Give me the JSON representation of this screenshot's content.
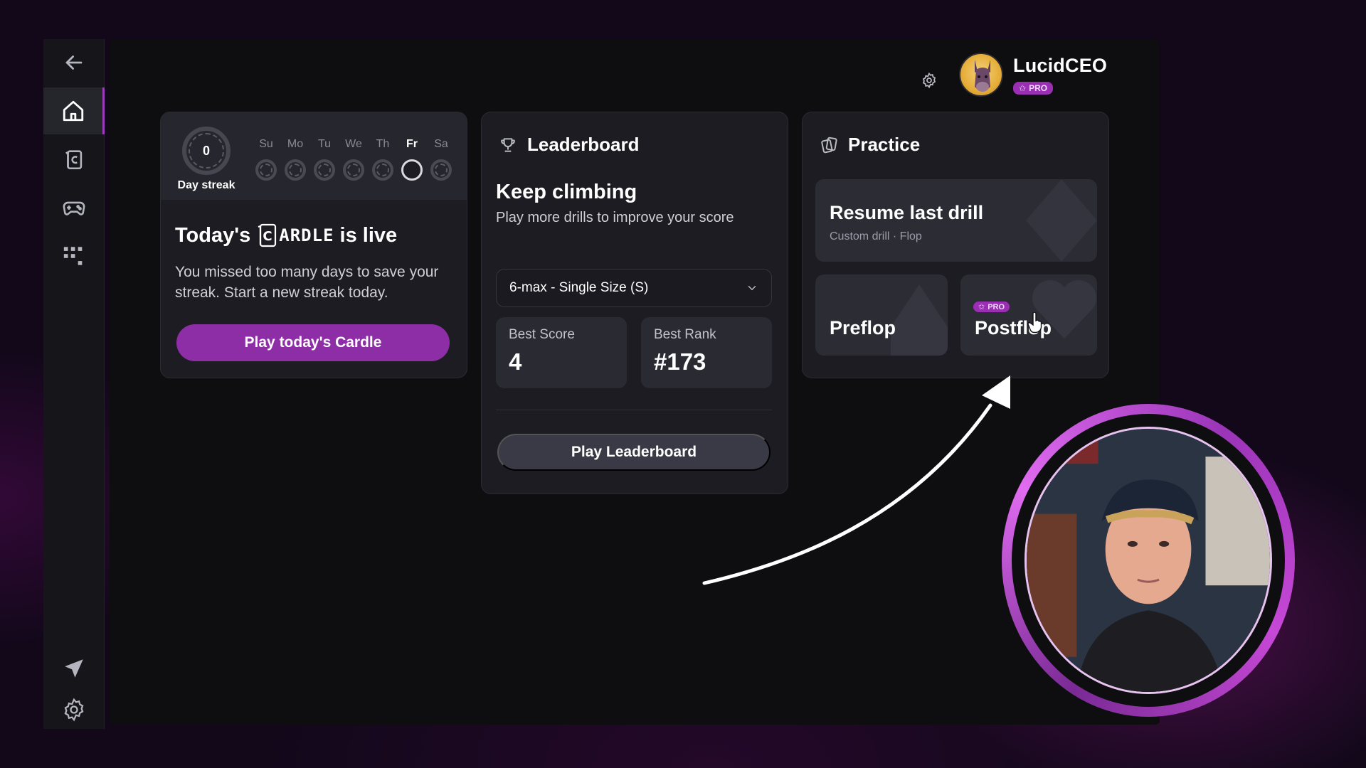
{
  "sidebar": {
    "items": [
      {
        "name": "back",
        "icon": "back-arrow-icon"
      },
      {
        "name": "home",
        "icon": "home-icon",
        "active": true
      },
      {
        "name": "cardle",
        "icon": "cardle-icon"
      },
      {
        "name": "games",
        "icon": "gamepad-icon"
      },
      {
        "name": "apps",
        "icon": "grid-icon"
      },
      {
        "name": "feedback",
        "icon": "send-icon"
      },
      {
        "name": "settings",
        "icon": "settings-icon"
      }
    ]
  },
  "user": {
    "name": "LucidCEO",
    "badge": "PRO"
  },
  "streak": {
    "count": "0",
    "label": "Day streak",
    "days": [
      "Su",
      "Mo",
      "Tu",
      "We",
      "Th",
      "Fr",
      "Sa"
    ],
    "today": "Fr"
  },
  "cardle": {
    "title_prefix": "Today's",
    "logo_text": "ARDLE",
    "logo_letter": "C",
    "title_suffix": "is live",
    "description": "You missed too many days to save your streak. Start a new streak today.",
    "button": "Play today's Cardle"
  },
  "leaderboard": {
    "heading": "Leaderboard",
    "title": "Keep climbing",
    "subtitle": "Play more drills to improve your score",
    "select_value": "6-max - Single Size (S)",
    "best_score_label": "Best Score",
    "best_score": "4",
    "best_rank_label": "Best Rank",
    "best_rank": "#173",
    "button": "Play Leaderboard"
  },
  "practice": {
    "heading": "Practice",
    "resume_title": "Resume last drill",
    "resume_sub": "Custom drill · Flop",
    "preflop": "Preflop",
    "postflop": "Postflop",
    "postflop_badge": "PRO"
  },
  "colors": {
    "accent": "#8e2ea7",
    "background": "#0e0e11",
    "card": "#1c1c22"
  }
}
